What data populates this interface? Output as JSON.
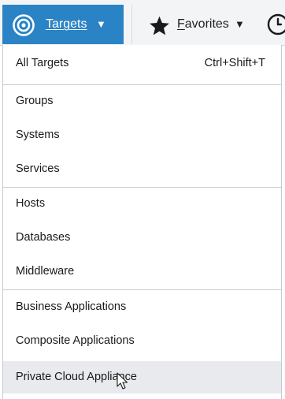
{
  "menubar": {
    "targets": {
      "label": "Targets",
      "icon": "targets-icon",
      "caret": "▼"
    },
    "favorites": {
      "label_first": "F",
      "label_rest": "avorites",
      "icon": "star-icon",
      "caret": "▼"
    },
    "history": {
      "icon": "history-icon"
    }
  },
  "dropdown": {
    "all_targets": {
      "label": "All Targets",
      "shortcut": "Ctrl+Shift+T"
    },
    "group1": [
      {
        "label": "Groups"
      },
      {
        "label": "Systems"
      },
      {
        "label": "Services"
      }
    ],
    "group2": [
      {
        "label": "Hosts"
      },
      {
        "label": "Databases"
      },
      {
        "label": "Middleware"
      }
    ],
    "group3": [
      {
        "label": "Business Applications"
      },
      {
        "label": "Composite Applications"
      },
      {
        "label": "Private Cloud Appliance"
      }
    ]
  },
  "colors": {
    "accent": "#2a83c5",
    "hover": "#e8eaed"
  }
}
